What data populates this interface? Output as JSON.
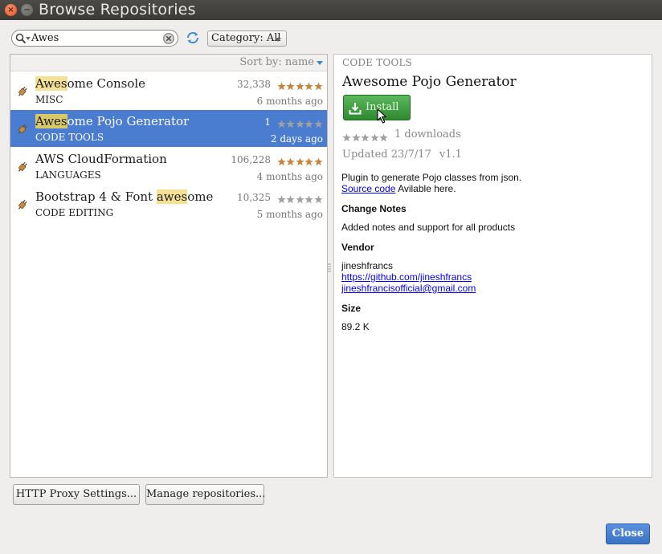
{
  "window": {
    "title": "Browse Repositories",
    "close_glyph": "×",
    "min_glyph": "−"
  },
  "toolbar": {
    "search_value": "Awes",
    "category_label": "Category: All"
  },
  "list": {
    "sort_label": "Sort by: name",
    "plugins": [
      {
        "name_highlight": "Awes",
        "name_rest": "ome Console",
        "name_prefix": "",
        "category": "MISC",
        "downloads": "32,338",
        "rating_stars": 5,
        "updated": "6 months ago",
        "selected": false
      },
      {
        "name_highlight": "Awes",
        "name_rest": "ome Pojo Generator",
        "name_prefix": "",
        "category": "CODE TOOLS",
        "downloads": "1",
        "rating_stars": 0,
        "updated": "2 days ago",
        "selected": true
      },
      {
        "name_highlight": "",
        "name_rest": "",
        "name_prefix": "AWS CloudFormation",
        "category": "LANGUAGES",
        "downloads": "106,228",
        "rating_stars": 5,
        "updated": "4 months ago",
        "selected": false
      },
      {
        "name_prefix": "Bootstrap 4 & Font ",
        "name_highlight": "awes",
        "name_rest": "ome",
        "category": "CODE EDITING",
        "downloads": "10,325",
        "rating_stars": 0,
        "updated": "5 months ago",
        "selected": false
      }
    ]
  },
  "detail": {
    "category": "CODE TOOLS",
    "title": "Awesome Pojo Generator",
    "install_label": "Install",
    "downloads": "1 downloads",
    "rating_stars": 0,
    "updated": "Updated 23/7/17",
    "version": "v1.1",
    "description": "Plugin to generate Pojo classes from json.",
    "source_link": "Source code",
    "source_suffix": " Avilable here.",
    "change_notes_heading": "Change Notes",
    "change_notes": "Added notes and support for all products",
    "vendor_heading": "Vendor",
    "vendor_name": "jineshfrancs",
    "vendor_url": "https://github.com/jineshfrancs",
    "vendor_email": "jineshfrancisofficial@gmail.com",
    "size_heading": "Size",
    "size": "89.2 K"
  },
  "buttons": {
    "http_proxy": "HTTP Proxy Settings...",
    "manage_repos": "Manage repositories...",
    "close": "Close"
  },
  "colors": {
    "selection": "#4a7cd0",
    "highlight": "#f4e196",
    "star_filled": "#c8843a",
    "star_empty": "#a0a0a0",
    "install_green": "#3c963c",
    "close_blue": "#3a72c4"
  },
  "icons": [
    "search-icon",
    "clear-icon",
    "refresh-icon",
    "plugin-icon",
    "star-icon",
    "download-icon",
    "cursor-icon"
  ]
}
